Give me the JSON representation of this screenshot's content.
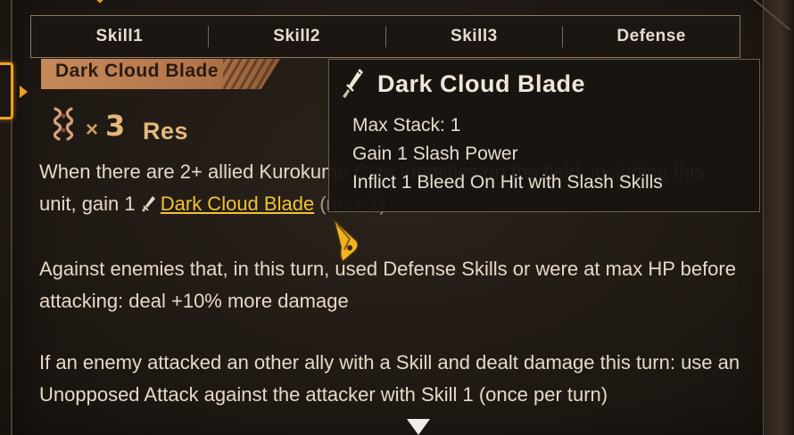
{
  "tabs": [
    {
      "label": "Skill1"
    },
    {
      "label": "Skill2"
    },
    {
      "label": "Skill3"
    },
    {
      "label": "Defense"
    }
  ],
  "passive": {
    "name": "Dark Cloud Blade",
    "condition": {
      "x": "×",
      "count": "3",
      "label": "Res",
      "icon": "res-sin-icon"
    },
    "description": {
      "p1_before": "When there are 2+ allied Kurokumo Clan Identities on the field, including this unit, gain 1 ",
      "p1_link": "Dark Cloud Blade",
      "p1_after": " (max 1)",
      "p2": "Against enemies that, in this turn, used Defense Skills or were at max HP before attacking: deal +10% more damage",
      "p3": "If an enemy attacked an other ally with a Skill and dealt damage this turn: use an Unopposed Attack against the attacker with Skill 1 (once per turn)"
    }
  },
  "tooltip": {
    "title": "Dark Cloud Blade",
    "icon": "blade-icon",
    "lines": [
      "Max Stack: 1",
      "Gain 1 Slash Power",
      "Inflict 1 Bleed On Hit with Slash Skills"
    ]
  },
  "colors": {
    "accent": "#f0a020",
    "keyword": "#f1c232",
    "res": "#e6b77d",
    "text": "#e7d9c7"
  }
}
